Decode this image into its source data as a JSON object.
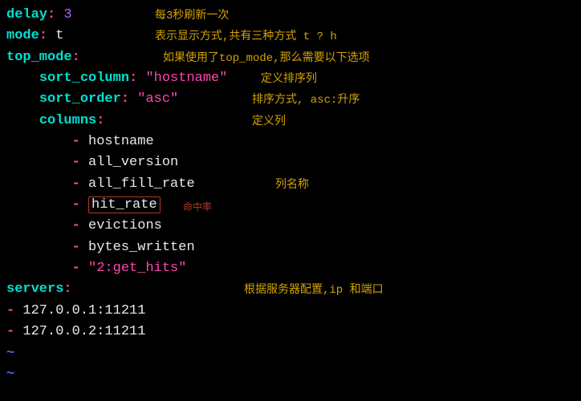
{
  "lines": {
    "delay_key": "delay",
    "delay_val": "3",
    "delay_comment": "每3秒刷新一次",
    "mode_key": "mode",
    "mode_val": "t",
    "mode_comment": "表示显示方式,共有三种方式 t ? h",
    "top_mode_key": "top_mode",
    "top_mode_comment": "如果使用了top_mode,那么需要以下选项",
    "sort_column_key": "sort_column",
    "sort_column_val": "\"hostname\"",
    "sort_column_comment": "定义排序列",
    "sort_order_key": "sort_order",
    "sort_order_val": "\"asc\"",
    "sort_order_comment": "排序方式, asc:升序",
    "columns_key": "columns",
    "columns_comment": "定义列",
    "col1": "hostname",
    "col2": "all_version",
    "col3": "all_fill_rate",
    "col3_comment": "列名称",
    "col4": "hit_rate",
    "col4_comment": "命中率",
    "col5": "evictions",
    "col6": "bytes_written",
    "col7": "\"2:get_hits\"",
    "servers_key": "servers",
    "servers_comment": "根据服务器配置,ip 和端口",
    "server1": "127.0.0.1:11211",
    "server2": "127.0.0.2:11211",
    "tilde": "~"
  }
}
